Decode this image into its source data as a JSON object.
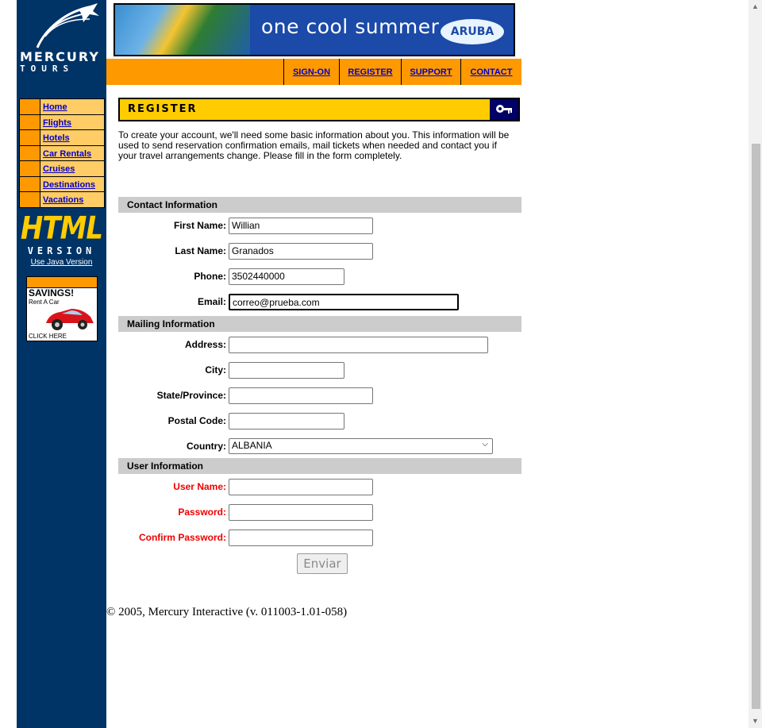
{
  "logo": {
    "line1": "MERCURY",
    "line2": "TOURS"
  },
  "left_nav": {
    "items": [
      {
        "label": "Home"
      },
      {
        "label": "Flights"
      },
      {
        "label": "Hotels"
      },
      {
        "label": "Car Rentals"
      },
      {
        "label": "Cruises"
      },
      {
        "label": "Destinations"
      },
      {
        "label": "Vacations"
      }
    ]
  },
  "html_version": {
    "big": "HTML",
    "sub": "VERSION",
    "java_link": "Use Java Version"
  },
  "ad": {
    "title": "SAVINGS!",
    "sub": "Rent A Car",
    "cta": "CLICK HERE"
  },
  "banner": {
    "text": "one cool summer",
    "brand": "ARUBA"
  },
  "top_nav": {
    "signon": "SIGN-ON",
    "register": "REGISTER",
    "support": "SUPPORT",
    "contact": "CONTACT"
  },
  "page": {
    "title": "REGISTER",
    "intro": "To create your account, we'll need some basic information about you. This information will be used to send reservation confirmation emails, mail tickets when needed and contact you if your travel arrangements change. Please fill in the form completely."
  },
  "sections": {
    "contact": "Contact Information",
    "mailing": "Mailing Information",
    "user": "User Information"
  },
  "fields": {
    "first_name": {
      "label": "First Name:",
      "value": "Willian"
    },
    "last_name": {
      "label": "Last Name:",
      "value": "Granados"
    },
    "phone": {
      "label": "Phone:",
      "value": "3502440000"
    },
    "email": {
      "label": "Email:",
      "value": "correo@prueba.com"
    },
    "address": {
      "label": "Address:",
      "value": ""
    },
    "city": {
      "label": "City:",
      "value": ""
    },
    "state": {
      "label": "State/Province:",
      "value": ""
    },
    "postal": {
      "label": "Postal Code:",
      "value": ""
    },
    "country": {
      "label": "Country:",
      "value": "ALBANIA"
    },
    "username": {
      "label": "User Name:",
      "value": ""
    },
    "password": {
      "label": "Password:",
      "value": ""
    },
    "confirm": {
      "label": "Confirm Password:",
      "value": ""
    }
  },
  "submit_label": "Enviar",
  "footer": "© 2005, Mercury Interactive (v. 011003-1.01-058)",
  "colors": {
    "navy": "#003366",
    "orange": "#ff9900",
    "yellow": "#ffcc00",
    "nav_cell": "#ffcc66",
    "required_label": "#ee0000",
    "link": "#0000cc"
  }
}
